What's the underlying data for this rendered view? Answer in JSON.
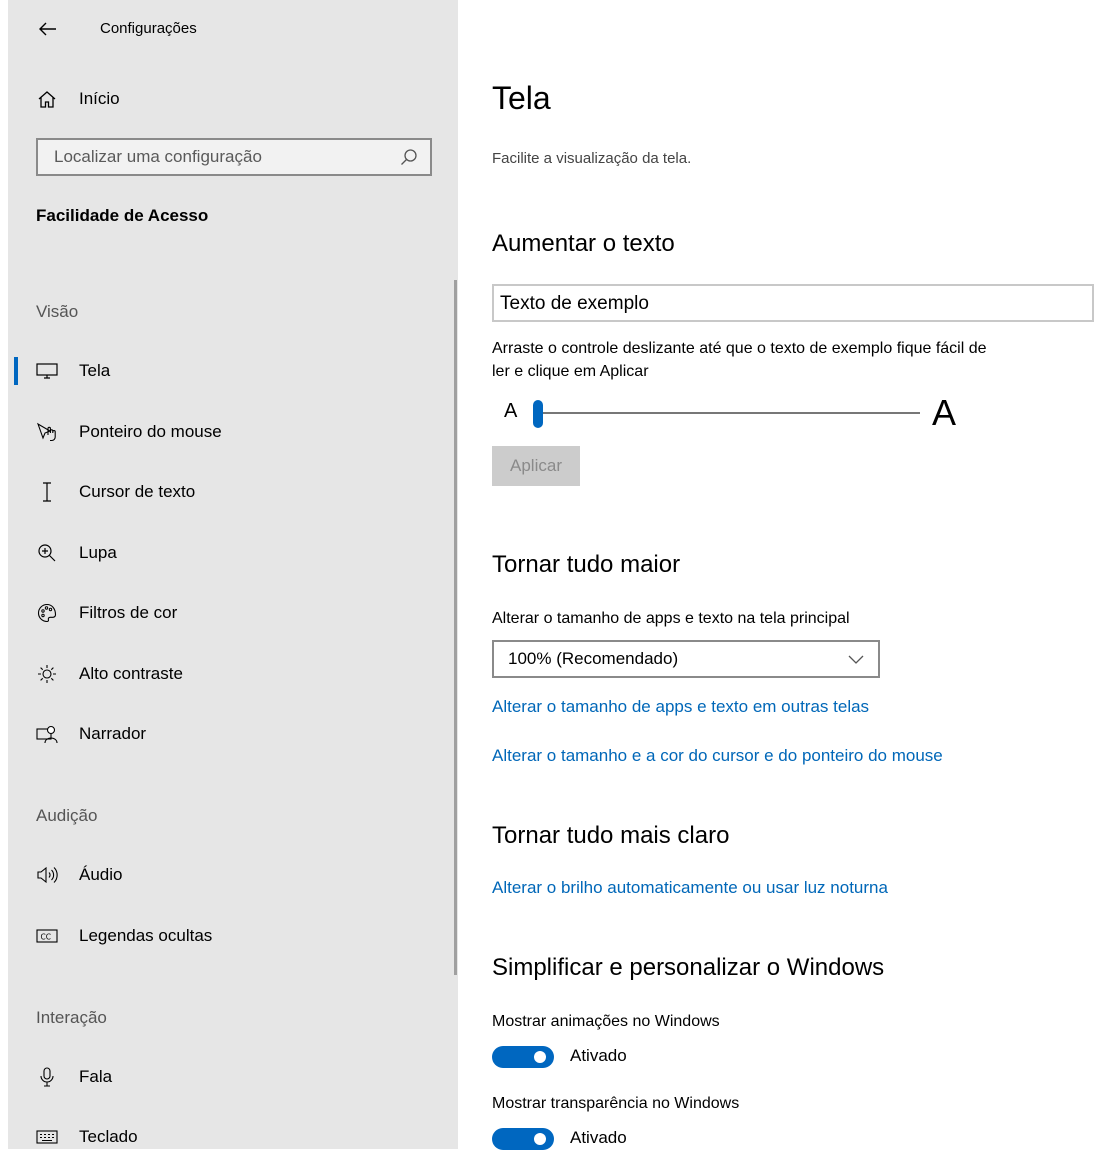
{
  "window": {
    "title": "Configurações"
  },
  "sidebar": {
    "home_label": "Início",
    "search_placeholder": "Localizar uma configuração",
    "section_title": "Facilidade de Acesso",
    "groups": {
      "visao": "Visão",
      "audicao": "Audição",
      "interacao": "Interação"
    },
    "items": {
      "tela": "Tela",
      "ponteiro": "Ponteiro do mouse",
      "cursor": "Cursor de texto",
      "lupa": "Lupa",
      "filtros": "Filtros de cor",
      "contraste": "Alto contraste",
      "narrador": "Narrador",
      "audio": "Áudio",
      "legendas": "Legendas ocultas",
      "fala": "Fala",
      "teclado": "Teclado"
    },
    "active_item": "Tela"
  },
  "main": {
    "title": "Tela",
    "subtitle": "Facilite a visualização da tela.",
    "text_size": {
      "heading": "Aumentar o texto",
      "sample": "Texto de exemplo",
      "description_line1": "Arraste o controle deslizante até que o texto de exemplo fique fácil de",
      "description_line2": "ler e clique em Aplicar",
      "slider_small_label": "A",
      "slider_large_label": "A",
      "slider_value_fraction": 0.0,
      "apply_label": "Aplicar"
    },
    "bigger": {
      "heading": "Tornar tudo maior",
      "label": "Alterar o tamanho de apps e texto na tela principal",
      "dropdown_value": "100% (Recomendado)",
      "link1": "Alterar o tamanho de apps e texto em outras telas",
      "link2": "Alterar o tamanho e a cor do cursor e do ponteiro do mouse"
    },
    "brighter": {
      "heading": "Tornar tudo mais claro",
      "link": "Alterar o brilho automaticamente ou usar luz noturna"
    },
    "simplify": {
      "heading": "Simplificar e personalizar o Windows",
      "animations_label": "Mostrar animações no Windows",
      "animations_state": "Ativado",
      "transparency_label": "Mostrar transparência no Windows",
      "transparency_state": "Ativado"
    }
  },
  "colors": {
    "accent": "#0067c0",
    "link": "#0067b8",
    "sidebar_bg": "#e6e6e6"
  }
}
